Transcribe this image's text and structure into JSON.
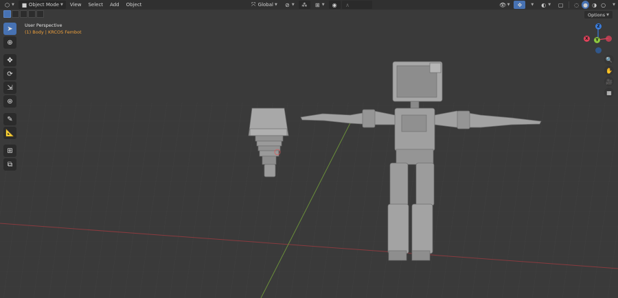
{
  "header": {
    "editor_type_icon": "3d-viewport-icon",
    "mode": "Object Mode",
    "menus": [
      "View",
      "Select",
      "Add",
      "Object"
    ],
    "transform_orientation": "Global",
    "options_label": "Options"
  },
  "viewport": {
    "title": "User Perspective",
    "subtitle": "(1) Body | KRCOS Fembot"
  },
  "toolbar": {
    "tools": [
      "select-box-icon",
      "cursor-icon",
      "move-icon",
      "rotate-icon",
      "scale-icon",
      "transform-icon",
      "annotate-icon",
      "measure-icon",
      "add-cube-icon",
      "extrude-icon"
    ]
  },
  "gizmo": {
    "x_label": "X",
    "y_label": "Y",
    "z_label": "Z"
  },
  "colors": {
    "background": "#3a3a3a",
    "header": "#303030",
    "accent": "#4772b3",
    "x_axis": "#e0425a",
    "y_axis": "#8cc63f",
    "z_axis": "#3b7ddd",
    "subtitle": "#f0a13c"
  }
}
